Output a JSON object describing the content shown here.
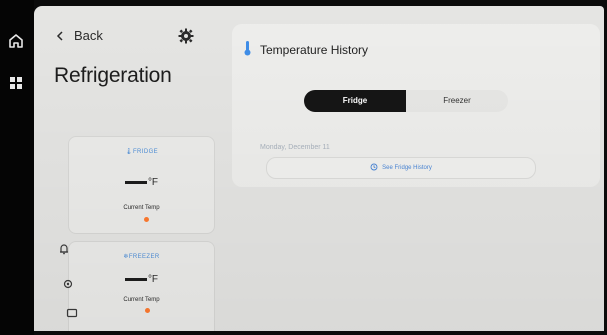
{
  "nav": {
    "back_label": "Back"
  },
  "page": {
    "title": "Refrigeration"
  },
  "cards": {
    "fridge": {
      "label": "FRIDGE",
      "temp_value": "",
      "unit": "°F",
      "sub_label": "Current Temp"
    },
    "freezer": {
      "label": "FREEZER",
      "temp_value": "",
      "unit": "°F",
      "sub_label": "Current Temp"
    }
  },
  "history": {
    "title": "Temperature History",
    "tabs": [
      "Fridge",
      "Freezer"
    ],
    "active_tab": "Fridge",
    "date": "Monday, December 11",
    "button_label": "See Fridge History"
  },
  "colors": {
    "accent_blue": "#4a86d6",
    "status_orange": "#ff7a2f",
    "segment_active": "#151515"
  }
}
